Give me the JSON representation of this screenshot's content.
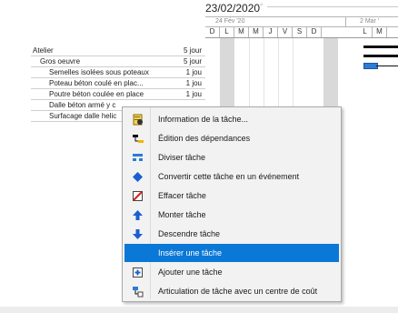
{
  "gantt": {
    "date": "23/02/2020",
    "week_labels": [
      "24 Fév '20",
      "2 Mar '"
    ],
    "days": [
      "D",
      "L",
      "M",
      "M",
      "J",
      "V",
      "S",
      "D",
      "L",
      "M"
    ]
  },
  "tasks": [
    {
      "name": "Atelier",
      "duration": "5 jour",
      "indent": 0
    },
    {
      "name": "Gros oeuvre",
      "duration": "5 jour",
      "indent": 1
    },
    {
      "name": "Semelles isolées sous poteaux",
      "duration": "1 jou",
      "indent": 2
    },
    {
      "name": "Poteau  béton  coulé en plac...",
      "duration": "1 jou",
      "indent": 2
    },
    {
      "name": "Poutre béton coulée en place",
      "duration": "1 jou",
      "indent": 2
    },
    {
      "name": "Dalle béton armé y c",
      "duration": "",
      "indent": 2
    },
    {
      "name": "Surfacage dalle helic",
      "duration": "",
      "indent": 2
    }
  ],
  "context_menu": {
    "items": [
      {
        "label": "Information de la tâche...",
        "icon": "task-info-icon"
      },
      {
        "label": "Édition des dépendances",
        "icon": "dependencies-icon"
      },
      {
        "label": "Diviser tâche",
        "icon": "split-task-icon"
      },
      {
        "label": "Convertir cette tâche en un événement",
        "icon": "event-diamond-icon"
      },
      {
        "label": "Effacer tâche",
        "icon": "delete-task-icon"
      },
      {
        "label": "Monter tâche",
        "icon": "arrow-up-icon"
      },
      {
        "label": "Descendre tâche",
        "icon": "arrow-down-icon"
      },
      {
        "label": "Insérer une tâche",
        "icon": "",
        "selected": true
      },
      {
        "label": "Ajouter une tâche",
        "icon": "add-task-icon"
      },
      {
        "label": "Articulation de tâche avec un centre de coût",
        "icon": "cost-center-icon"
      }
    ]
  },
  "colors": {
    "selection": "#0a78d7",
    "weekend_shade": "#d9d9d9",
    "progress_bar": "#2c7bd6"
  }
}
